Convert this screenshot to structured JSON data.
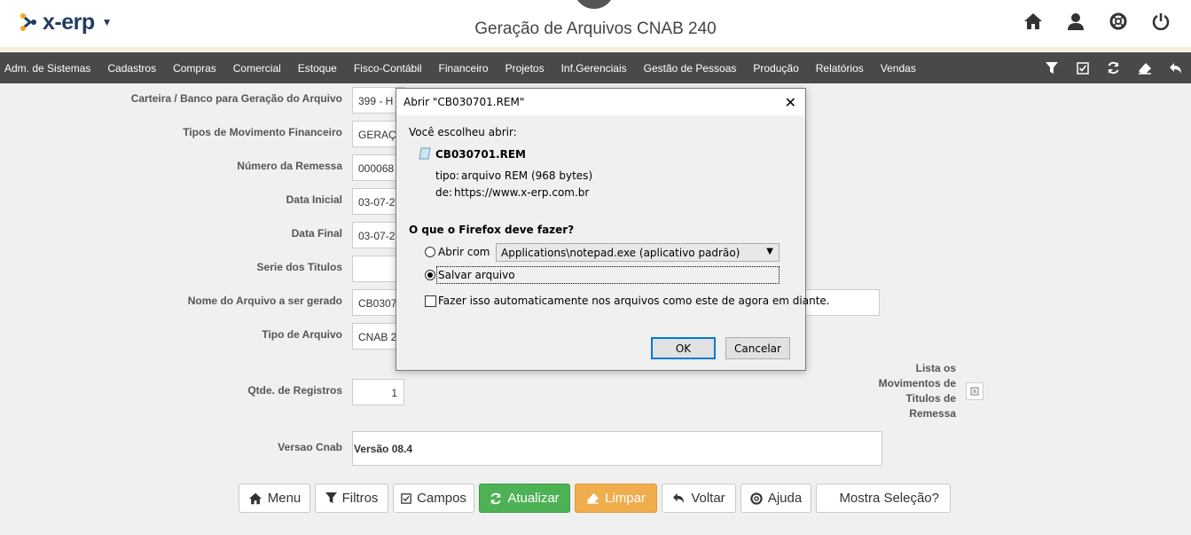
{
  "header": {
    "logo_text": "x-erp",
    "title": "Geração de Arquivos CNAB 240",
    "icons": [
      "home-icon",
      "user-icon",
      "lifebuoy-icon",
      "power-icon"
    ]
  },
  "menu": {
    "items": [
      "Adm. de Sistemas",
      "Cadastros",
      "Compras",
      "Comercial",
      "Estoque",
      "Fisco-Contábil",
      "Financeiro",
      "Projetos",
      "Inf.Gerenciais",
      "Gestão de Pessoas",
      "Produção",
      "Relatórios",
      "Vendas"
    ],
    "tools": [
      "filter-icon",
      "checkbox-icon",
      "refresh-icon",
      "eraser-icon",
      "back-icon"
    ]
  },
  "form": {
    "carteira_label": "Carteira / Banco para Geração do Arquivo",
    "carteira_value": "399 - H",
    "tipos_label": "Tipos de Movimento Financeiro",
    "tipos_value": "GERAÇ",
    "numero_label": "Número da Remessa",
    "numero_value": "000068",
    "data_inicial_label": "Data Inicial",
    "data_inicial_value": "03-07-2",
    "data_final_label": "Data Final",
    "data_final_value": "03-07-2",
    "serie_label": "Serie dos Titulos",
    "serie_value": "",
    "nome_label": "Nome do Arquivo a ser gerado",
    "nome_value": "CB0307",
    "tipo_arquivo_label": "Tipo de Arquivo",
    "tipo_arquivo_value": "CNAB 2",
    "qtde_label": "Qtde. de Registros",
    "qtde_value": "1",
    "versao_label": "Versao Cnab",
    "versao_value": "Versão 08.4",
    "lista_label": "Lista os Movimentos de Titulos de Remessa"
  },
  "buttons": {
    "menu": "Menu",
    "filtros": "Filtros",
    "campos": "Campos",
    "atualizar": "Atualizar",
    "limpar": "Limpar",
    "voltar": "Voltar",
    "ajuda": "Ajuda",
    "mostra": "Mostra Seleção?"
  },
  "dialog": {
    "title": "Abrir \"CB030701.REM\"",
    "close": "✕",
    "chose_text": "Você escolheu abrir:",
    "filename": "CB030701.REM",
    "tipo_label": "tipo:",
    "tipo_value": "arquivo REM (968 bytes)",
    "de_label": "de:",
    "de_value": "https://www.x-erp.com.br",
    "question": "O que o Firefox deve fazer?",
    "open_with_label": "Abrir com",
    "open_with_value": "Applications\\notepad.exe (aplicativo padrão)",
    "save_label": "Salvar arquivo",
    "auto_label": "Fazer isso automaticamente nos arquivos como este de agora em diante.",
    "ok": "OK",
    "cancel": "Cancelar"
  },
  "colors": {
    "menubar": "#494949",
    "logo": "#1f3c5e",
    "logo_accent": "#f5a623",
    "green": "#4db255",
    "orange": "#f0ad4e"
  }
}
